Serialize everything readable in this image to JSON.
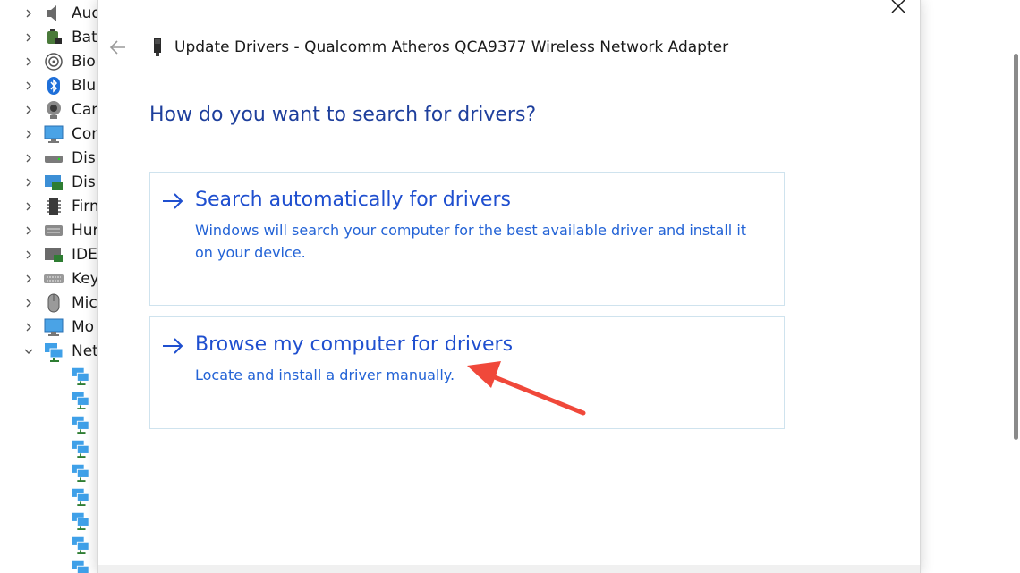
{
  "tree": {
    "items": [
      {
        "label": "Aud",
        "icon": "speaker-icon"
      },
      {
        "label": "Batt",
        "icon": "battery-icon"
      },
      {
        "label": "Bior",
        "icon": "fingerprint-icon"
      },
      {
        "label": "Blue",
        "icon": "bluetooth-icon"
      },
      {
        "label": "Can",
        "icon": "camera-icon"
      },
      {
        "label": "Con",
        "icon": "monitor-icon"
      },
      {
        "label": "Disk",
        "icon": "disk-drive-icon"
      },
      {
        "label": "Disp",
        "icon": "display-adapter-icon"
      },
      {
        "label": "Firm",
        "icon": "firmware-icon"
      },
      {
        "label": "Hur",
        "icon": "hid-icon"
      },
      {
        "label": "IDE",
        "icon": "ide-controller-icon"
      },
      {
        "label": "Key",
        "icon": "keyboard-icon"
      },
      {
        "label": "Mic",
        "icon": "mouse-icon"
      },
      {
        "label": "Mo",
        "icon": "monitor-icon"
      },
      {
        "label": "Net",
        "icon": "network-adapter-icon",
        "expanded": true
      }
    ],
    "network_children_count_visible": 9
  },
  "dialog": {
    "title": "Update Drivers - Qualcomm Atheros QCA9377 Wireless Network Adapter",
    "question": "How do you want to search for drivers?",
    "options": [
      {
        "title": "Search automatically for drivers",
        "description": "Windows will search your computer for the best available driver and install it on your device."
      },
      {
        "title": "Browse my computer for drivers",
        "description": "Locate and install a driver manually."
      }
    ]
  },
  "colors": {
    "heading": "#1e3f9c",
    "link": "#1f4fcf",
    "annotation_arrow": "#f0483a"
  }
}
